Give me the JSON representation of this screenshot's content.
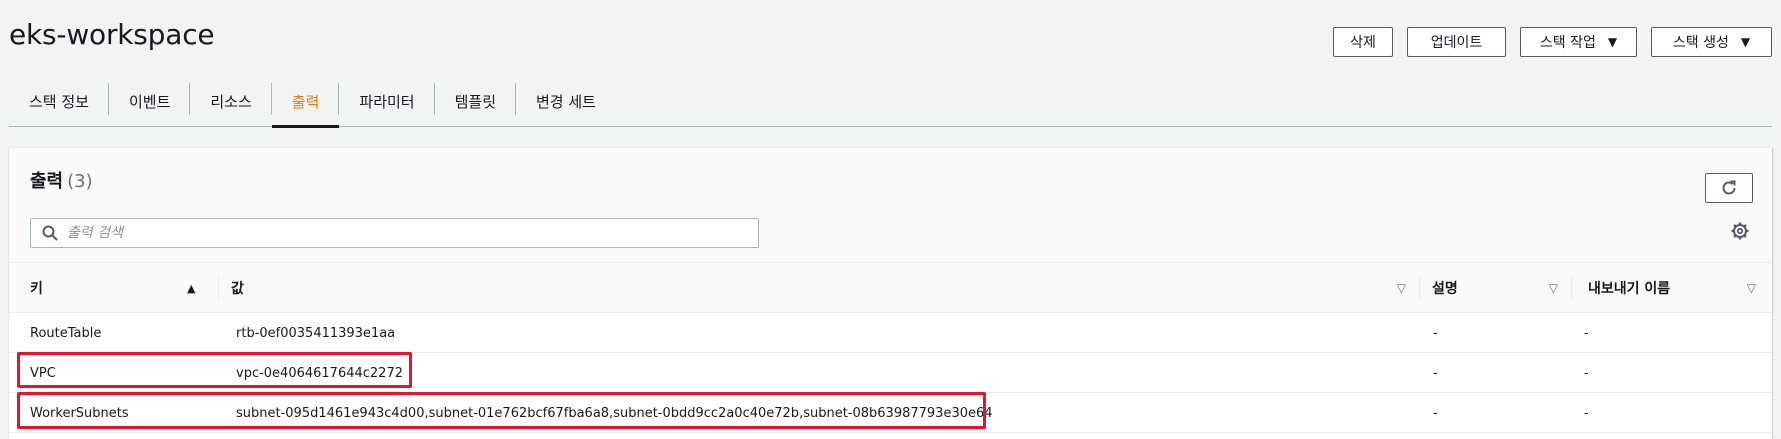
{
  "page": {
    "title": "eks-workspace"
  },
  "actions": {
    "delete": "삭제",
    "update": "업데이트",
    "stack_actions": "스택 작업",
    "create_stack": "스택 생성"
  },
  "tabs": [
    {
      "label": "스택 정보",
      "active": false
    },
    {
      "label": "이벤트",
      "active": false
    },
    {
      "label": "리소스",
      "active": false
    },
    {
      "label": "출력",
      "active": true
    },
    {
      "label": "파라미터",
      "active": false
    },
    {
      "label": "템플릿",
      "active": false
    },
    {
      "label": "변경 세트",
      "active": false
    }
  ],
  "outputs": {
    "title": "출력",
    "count": "(3)",
    "search_placeholder": "출력 검색",
    "columns": {
      "key": "키",
      "value": "값",
      "description": "설명",
      "export_name": "내보내기 이름"
    },
    "rows": [
      {
        "key": "RouteTable",
        "value": "rtb-0ef0035411393e1aa",
        "description": "-",
        "export_name": "-"
      },
      {
        "key": "VPC",
        "value": "vpc-0e4064617644c2272",
        "description": "-",
        "export_name": "-"
      },
      {
        "key": "WorkerSubnets",
        "value": "subnet-095d1461e943c4d00,subnet-01e762bcf67fba6a8,subnet-0bdd9cc2a0c40e72b,subnet-08b63987793e30e64",
        "description": "-",
        "export_name": "-"
      }
    ]
  },
  "icons": {
    "search": "search-icon",
    "refresh": "refresh-icon",
    "settings": "gear-icon",
    "sort_asc": "sort-ascending-icon",
    "sort_desc": "sort-descending-icon",
    "dropdown": "caret-down-icon"
  },
  "colors": {
    "active_tab": "#ec7211",
    "highlight": "#e0182d",
    "text": "#16191f"
  }
}
